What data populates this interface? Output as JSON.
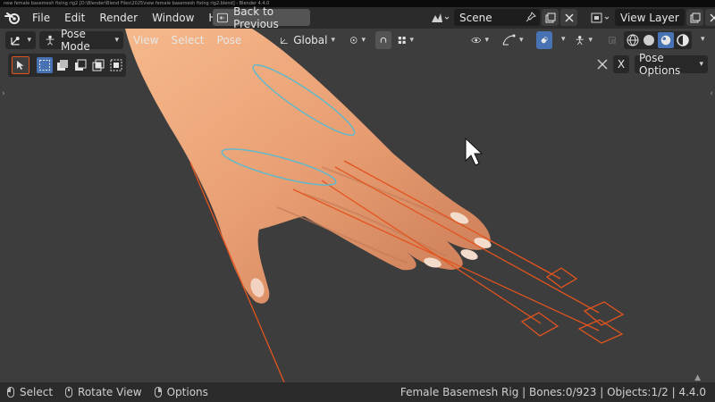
{
  "window_title": "new female basemesh fixing rig2 [D:\\Blender\\Blend Files\\2025\\new female basemesh fixing rig2.blend] - Blender 4.4.0",
  "menu": [
    "File",
    "Edit",
    "Render",
    "Window",
    "Help"
  ],
  "back_button": "Back to Previous",
  "scene": {
    "name": "Scene"
  },
  "view_layer": {
    "name": "View Layer"
  },
  "viewport_header": {
    "mode": "Pose Mode",
    "menus": [
      "View",
      "Select",
      "Pose"
    ],
    "transform_orientation": "Global"
  },
  "pose_options": {
    "close": "X",
    "label": "Pose Options"
  },
  "status": {
    "select": "Select",
    "rotate": "Rotate View",
    "options": "Options",
    "info": "Female Basemesh Rig | Bones:0/923 | Objects:1/2 | 4.4.0"
  },
  "colors": {
    "bone": "#e2541f",
    "selection": "#63b8c9",
    "accent": "#4772b3",
    "viewport_bg": "#3d3d3d"
  }
}
